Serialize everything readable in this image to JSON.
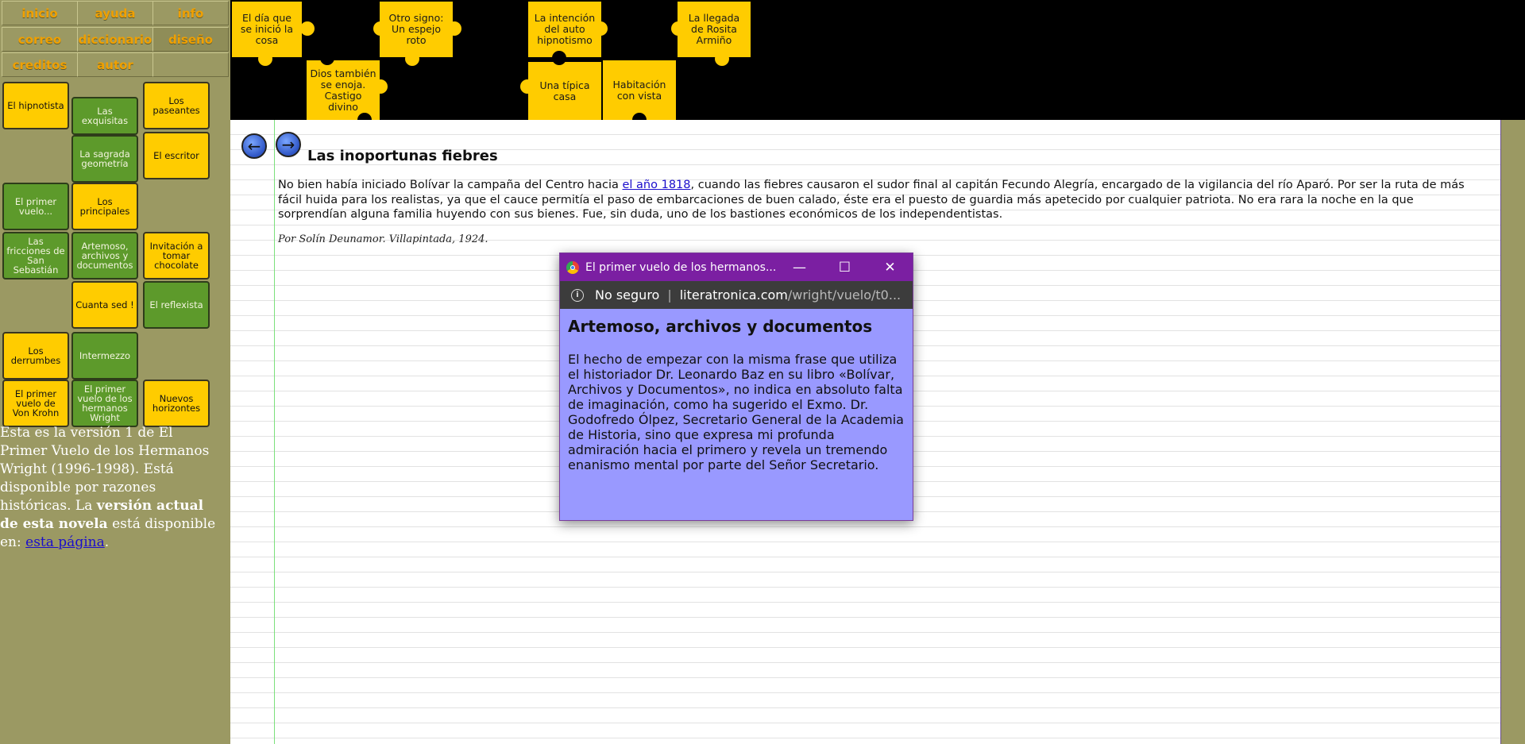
{
  "nav": [
    {
      "label": "inicio"
    },
    {
      "label": "ayuda"
    },
    {
      "label": "info"
    },
    {
      "label": "correo"
    },
    {
      "label": "diccionario"
    },
    {
      "label": "diseño"
    },
    {
      "label": "creditos"
    },
    {
      "label": "autor"
    }
  ],
  "puzzle_pieces": [
    {
      "label": "El hipnotista"
    },
    {
      "label": "Las exquisitas"
    },
    {
      "label": "Los paseantes"
    },
    {
      "label": "La sagrada geometría"
    },
    {
      "label": "El escritor"
    },
    {
      "label": "El primer vuelo..."
    },
    {
      "label": "Los principales"
    },
    {
      "label": "Las fricciones de San Sebastián"
    },
    {
      "label": "Artemoso, archivos y documentos"
    },
    {
      "label": "Invitación a tomar chocolate"
    },
    {
      "label": "Cuanta sed !"
    },
    {
      "label": "El reflexista"
    },
    {
      "label": "Los derrumbes"
    },
    {
      "label": "Intermezzo"
    },
    {
      "label": "El primer vuelo de Von Krohn"
    },
    {
      "label": "El primer vuelo de los hermanos Wright"
    },
    {
      "label": "Nuevos horizontes"
    }
  ],
  "sidenote": {
    "text1": "Esta es la versión 1 de El Primer Vuelo de los Hermanos Wright (1996-1998). Está disponible por razones históricas. La ",
    "bold": "versión actual de esta novela",
    "text2": " está disponible en: ",
    "link": "esta página",
    "end": "."
  },
  "top_pieces": [
    {
      "label": "El día que se inició la cosa"
    },
    {
      "label": "Otro signo: Un espejo roto"
    },
    {
      "label": "La intención del auto hipnotismo"
    },
    {
      "label": "La llegada de Rosita Armiño"
    },
    {
      "label": "Dios también se enoja. Castigo divino"
    },
    {
      "label": "Una típica casa"
    },
    {
      "label": "Habitación con vista"
    }
  ],
  "main": {
    "title": "Las inoportunas fiebres",
    "para_before": "No bien había iniciado Bolívar la campaña del Centro hacia ",
    "para_link": "el año 1818",
    "para_after": ", cuando las fiebres causaron el sudor final al capitán Fecundo Alegría, encargado de la vigilancia del río Aparó. Por ser la ruta de más fácil huida para los realistas, ya que el cauce permitía el paso de embarcaciones de buen calado, éste era el puesto de guardia más apetecido por cualquier patriota. No era rara la noche en la que sorprendían alguna familia huyendo con sus bienes. Fue, sin duda, uno de los bastiones económicos de los independentistas.",
    "signature": "Por Solín Deunamor. Villapintada, 1924."
  },
  "popup": {
    "window_title": "El primer vuelo de los hermanos...",
    "security": "No seguro",
    "url_host": "literatronica.com",
    "url_path": "/wright/vuelo/t0...",
    "heading": "Artemoso, archivos y documentos",
    "text": "El hecho de empezar con la misma frase que utiliza el historiador Dr. Leonardo Baz en su libro «Bolívar, Archivos y Documentos», no indica en absoluto falta de imaginación, como ha sugerido el Exmo. Dr. Godofredo Ólpez, Secretario General de la Academia de Historia, sino que expresa mi profunda admiración hacia el primero y revela un tremendo enanismo mental por parte del Señor Secretario."
  }
}
